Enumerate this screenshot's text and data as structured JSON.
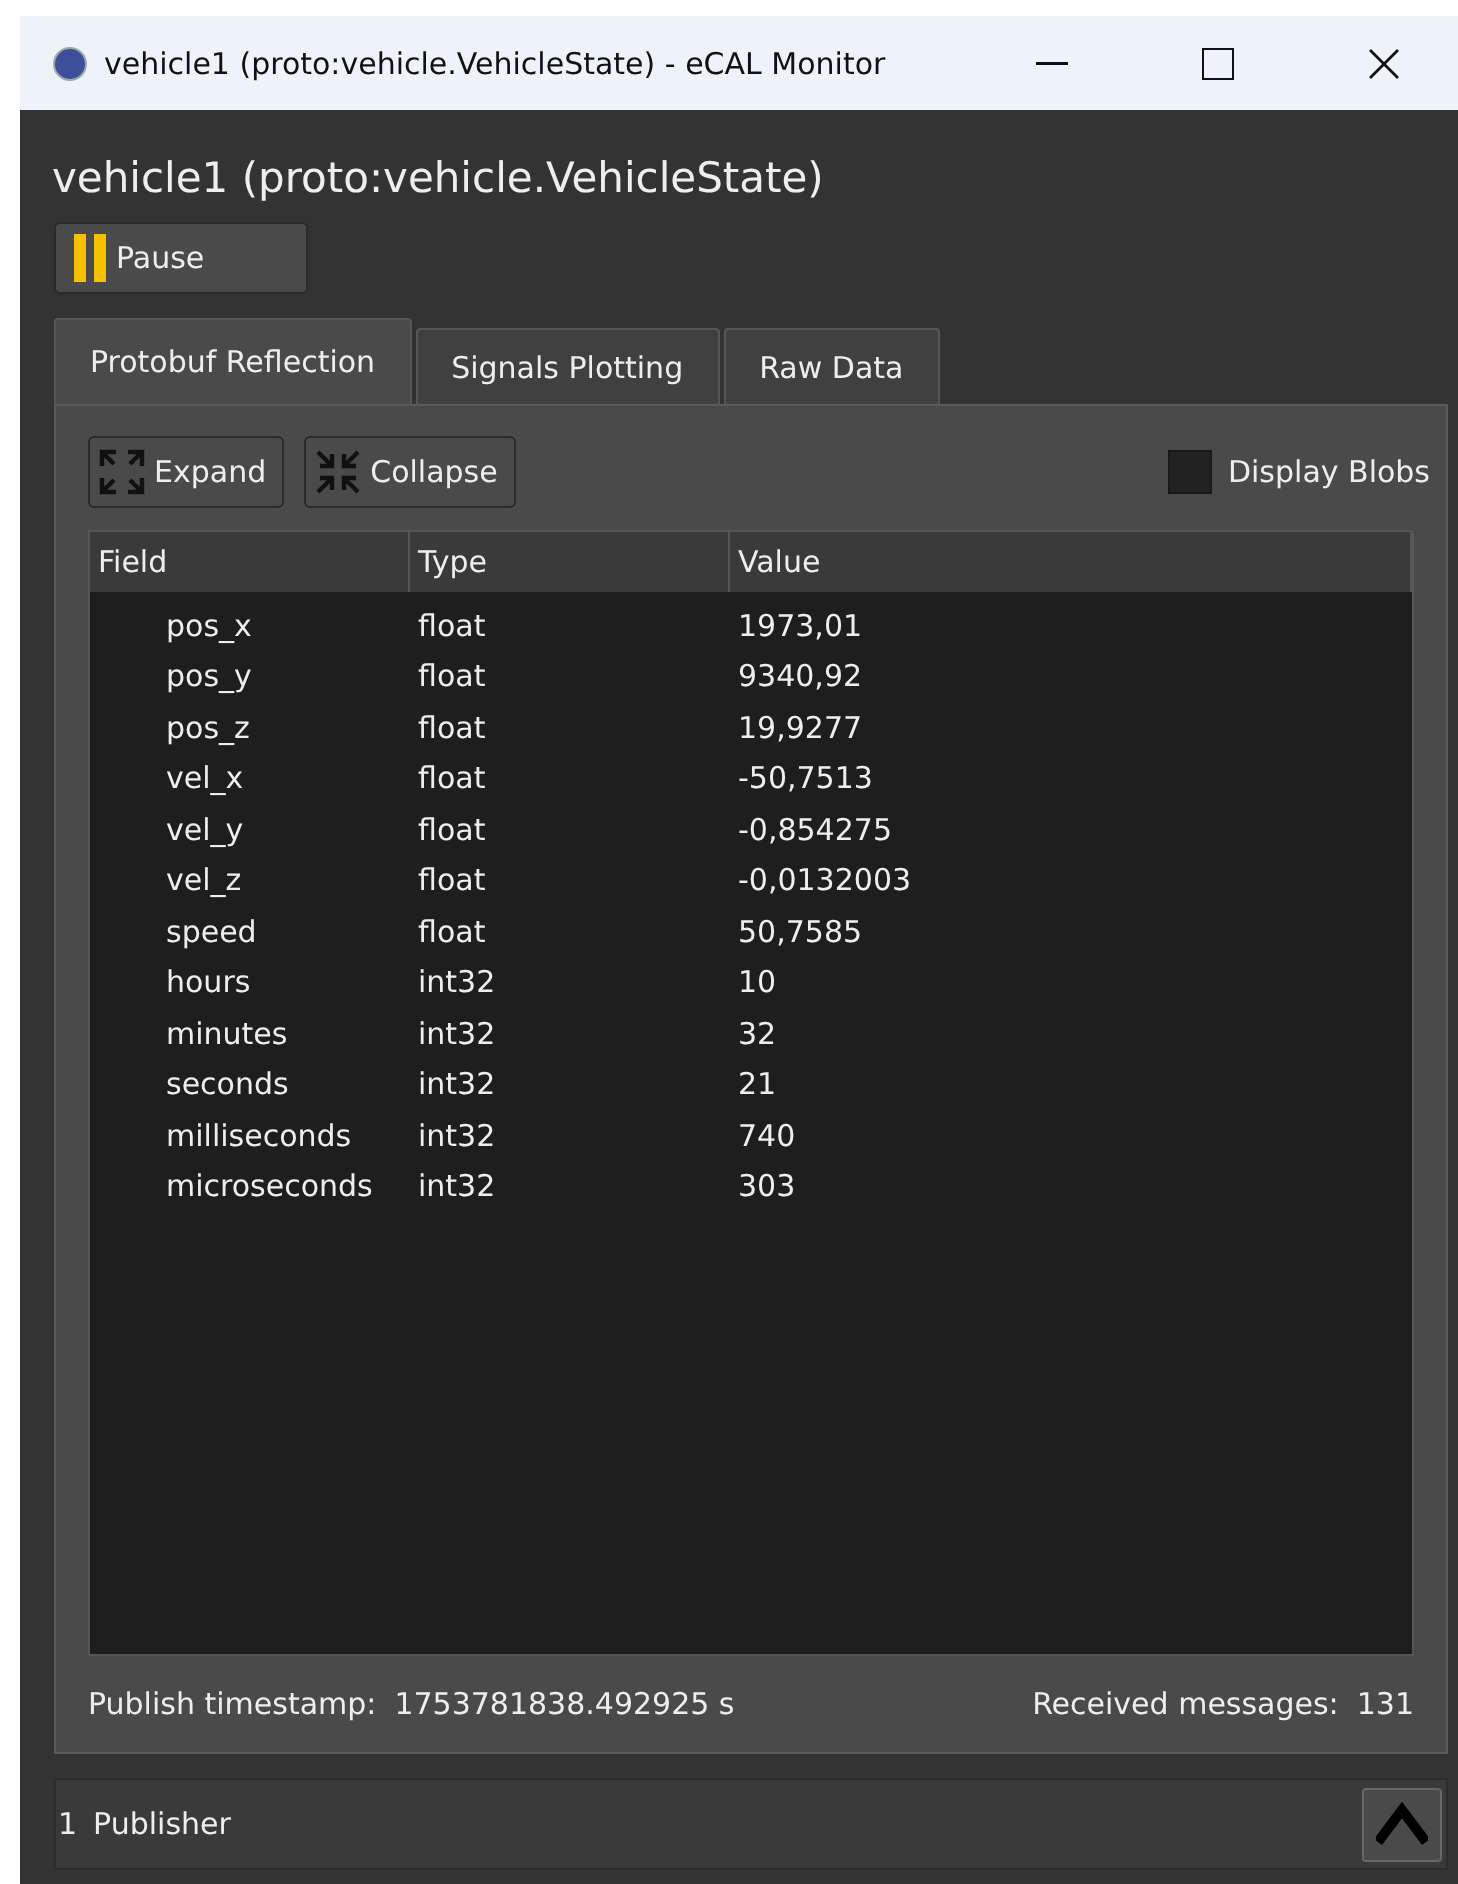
{
  "window": {
    "title": "vehicle1 (proto:vehicle.VehicleState) - eCAL Monitor"
  },
  "heading": "vehicle1 (proto:vehicle.VehicleState)",
  "pause_button": {
    "label": "Pause"
  },
  "tabs": [
    {
      "label": "Protobuf Reflection",
      "selected": true
    },
    {
      "label": "Signals Plotting",
      "selected": false
    },
    {
      "label": "Raw Data",
      "selected": false
    }
  ],
  "toolbar": {
    "expand": "Expand",
    "collapse": "Collapse",
    "display_blobs": {
      "label": "Display Blobs",
      "checked": false
    }
  },
  "table": {
    "columns": [
      "Field",
      "Type",
      "Value"
    ],
    "rows": [
      {
        "field": "pos_x",
        "type": "float",
        "value": "1973,01"
      },
      {
        "field": "pos_y",
        "type": "float",
        "value": "9340,92"
      },
      {
        "field": "pos_z",
        "type": "float",
        "value": "19,9277"
      },
      {
        "field": "vel_x",
        "type": "float",
        "value": "-50,7513"
      },
      {
        "field": "vel_y",
        "type": "float",
        "value": "-0,854275"
      },
      {
        "field": "vel_z",
        "type": "float",
        "value": "-0,0132003"
      },
      {
        "field": "speed",
        "type": "float",
        "value": "50,7585"
      },
      {
        "field": "hours",
        "type": "int32",
        "value": "10"
      },
      {
        "field": "minutes",
        "type": "int32",
        "value": "32"
      },
      {
        "field": "seconds",
        "type": "int32",
        "value": "21"
      },
      {
        "field": "milliseconds",
        "type": "int32",
        "value": "740"
      },
      {
        "field": "microseconds",
        "type": "int32",
        "value": "303"
      }
    ]
  },
  "footer": {
    "timestamp_label": "Publish timestamp:",
    "timestamp": "1753781838.492925 s",
    "received_label": "Received messages:",
    "received": "131"
  },
  "publishers": {
    "count": "1",
    "label": "Publisher"
  }
}
